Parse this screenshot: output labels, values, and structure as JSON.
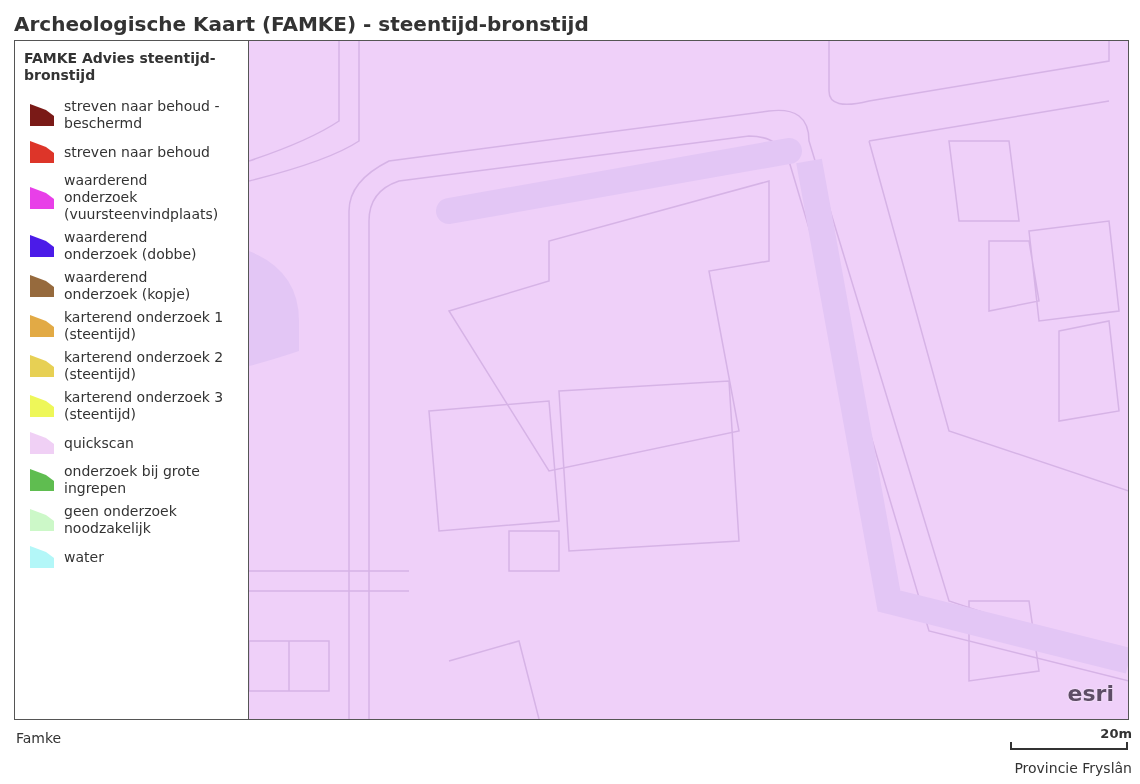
{
  "title": "Archeologische Kaart (FAMKE) - steentijd-bronstijd",
  "legend": {
    "title": "FAMKE Advies steentijd-bronstijd",
    "items": [
      {
        "label": "streven naar behoud - beschermd",
        "color": "#7a1a17"
      },
      {
        "label": "streven naar behoud",
        "color": "#dd3529"
      },
      {
        "label": "waarderend onderzoek (vuursteenvindplaats)",
        "color": "#e83fe8"
      },
      {
        "label": "waarderend onderzoek (dobbe)",
        "color": "#4b1be8"
      },
      {
        "label": "waarderend onderzoek (kopje)",
        "color": "#966a3d"
      },
      {
        "label": "karterend onderzoek 1 (steentijd)",
        "color": "#e2aa45"
      },
      {
        "label": "karterend onderzoek 2 (steentijd)",
        "color": "#e7d054"
      },
      {
        "label": "karterend onderzoek 3 (steentijd)",
        "color": "#eef759"
      },
      {
        "label": "quickscan",
        "color": "#f0d0f5"
      },
      {
        "label": "onderzoek bij grote ingrepen",
        "color": "#5fbd50"
      },
      {
        "label": "geen onderzoek noodzakelijk",
        "color": "#ccf8c8"
      },
      {
        "label": "water",
        "color": "#b3f7f8"
      }
    ]
  },
  "map": {
    "logo": "esri"
  },
  "footer": {
    "left": "Famke",
    "scale": "20m",
    "credit": "Provincie Fryslân"
  }
}
